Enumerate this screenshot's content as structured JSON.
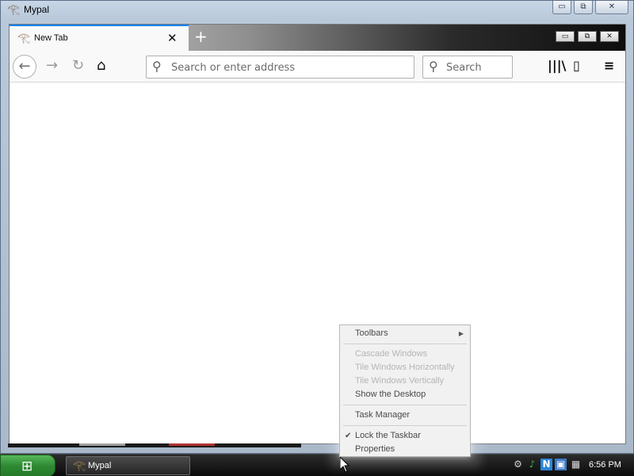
{
  "outer_window": {
    "title": "Mypal",
    "caption_buttons": {
      "minimize": "▭",
      "maximize": "⧉",
      "close": "✕"
    }
  },
  "browser": {
    "tab": {
      "title": "New Tab",
      "close_glyph": "✕"
    },
    "new_tab_glyph": "+",
    "window_buttons": {
      "minimize": "▭",
      "restore": "⧉",
      "close": "✕"
    },
    "nav": {
      "back": "←",
      "forward": "→",
      "reload": "↻",
      "home": "⌂"
    },
    "url_placeholder": "Search or enter address",
    "search_placeholder": "Search",
    "tools": {
      "library": "|||\\",
      "sidebar": "▯",
      "menu": "≡"
    }
  },
  "context_menu": {
    "items": [
      {
        "label": "Toolbars",
        "disabled": false,
        "submenu": true
      },
      {
        "label": "Cascade Windows",
        "disabled": true
      },
      {
        "label": "Tile Windows Horizontally",
        "disabled": true
      },
      {
        "label": "Tile Windows Vertically",
        "disabled": true
      },
      {
        "label": "Show the Desktop",
        "disabled": false
      },
      {
        "label": "Task Manager",
        "disabled": false
      },
      {
        "label": "Lock the Taskbar",
        "disabled": false,
        "checked": true
      },
      {
        "label": "Properties",
        "disabled": false
      }
    ],
    "submenu_glyph": "▶",
    "check_glyph": "✔"
  },
  "taskbar": {
    "start_logo": "⊞",
    "task_items": [
      {
        "label": "Mypal"
      }
    ],
    "tray": {
      "time": "6:56 PM"
    }
  },
  "colors": {
    "accent": "#0a84ff",
    "start_button": "#2f8a33"
  },
  "icons": {
    "app": "eye-of-horus-icon",
    "tray": [
      "network-icon",
      "volume-icon",
      "app-n-icon",
      "monitor-icon",
      "calendar-icon"
    ]
  }
}
